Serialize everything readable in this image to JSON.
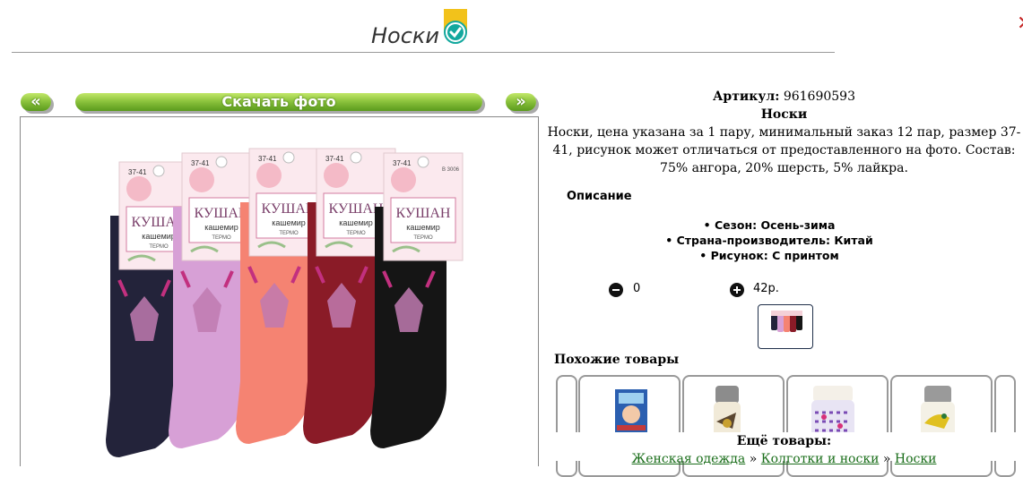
{
  "header": {
    "title": "Носки",
    "badge_color": "#f2c21b",
    "check_color": "#13a89e"
  },
  "gallery": {
    "prev_label": "«",
    "download_label": "Скачать фото",
    "next_label": "»",
    "accent": "#8dc43e"
  },
  "photo": {
    "size_tag": "37-41",
    "brand": "КУШАН",
    "material": "кашемир",
    "type": "ТЕРМО",
    "article_tag": "В 3006",
    "sock_colors": [
      "#23233a",
      "#d7a0d6",
      "#f58372",
      "#8a1b27",
      "#151515"
    ]
  },
  "product": {
    "article_label": "Артикул:",
    "article_value": "961690593",
    "name": "Носки",
    "description": "Носки, цена указана за 1 пару, минимальный заказ 12 пар, размер 37-41, рисунок может отличаться от предоставленного на фото. Состав: 75% ангора, 20% шерсть, 5% лайкра."
  },
  "specs": {
    "heading": "Описание",
    "items": [
      "Сезон: Осень-зима",
      "Страна-производитель: Китай",
      "Рисунок: С принтом"
    ]
  },
  "cart": {
    "quantity": "0",
    "price": "42р."
  },
  "similar": {
    "heading": "Похожие товары"
  },
  "more": {
    "title": "Ещё товары:",
    "crumb1": "Женская одежда",
    "crumb2": "Колготки и носки",
    "crumb3": "Носки",
    "sep": " » "
  }
}
